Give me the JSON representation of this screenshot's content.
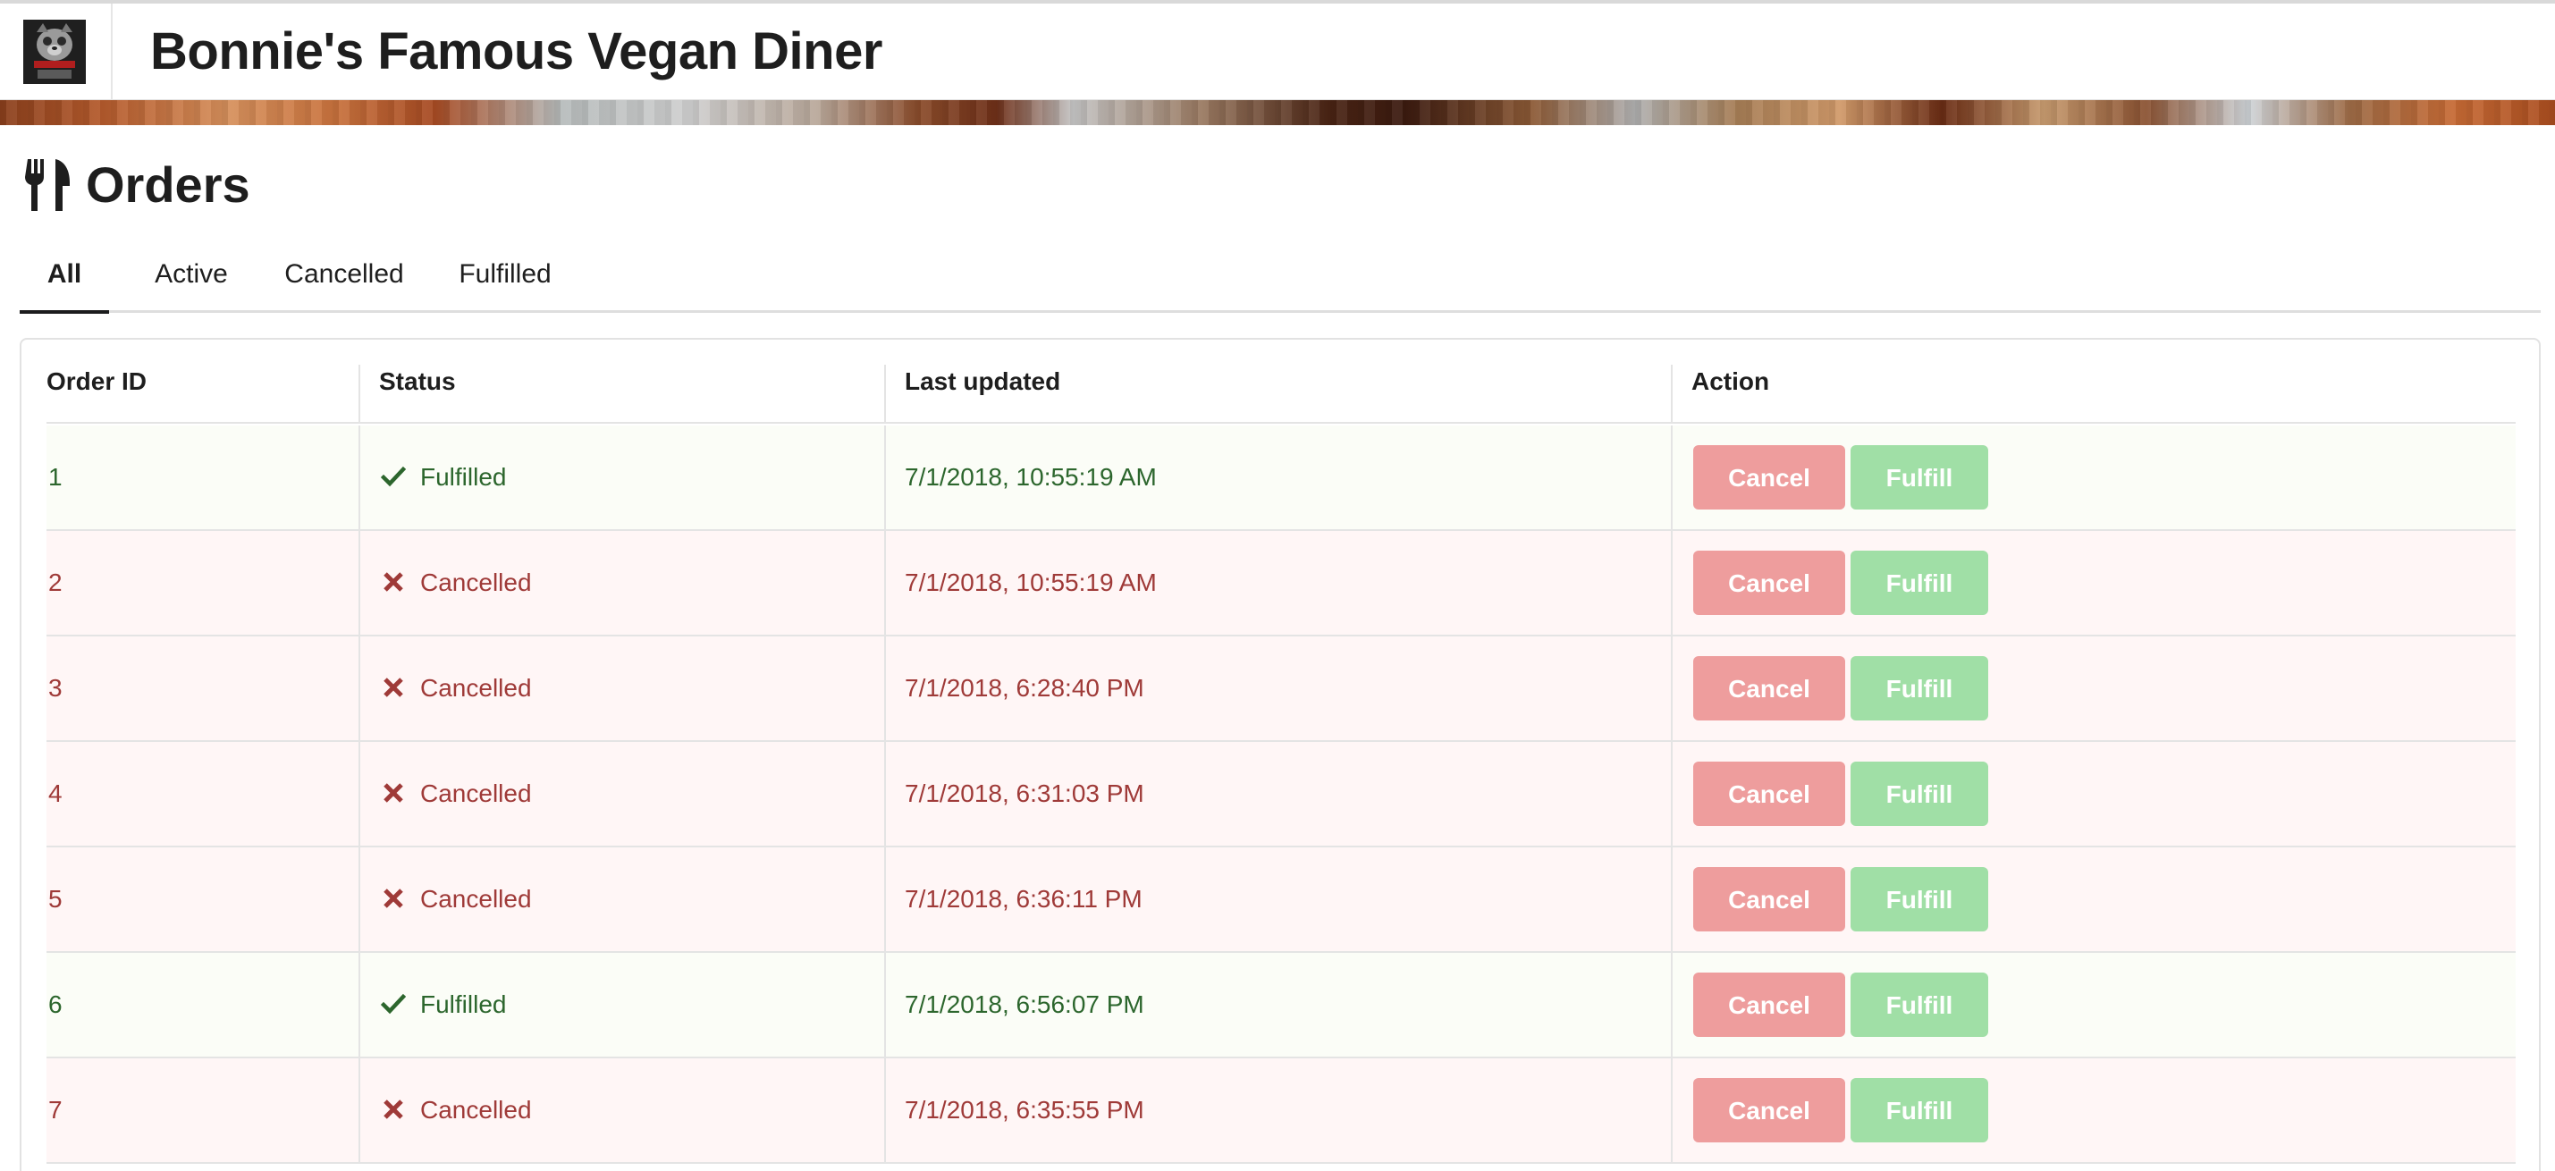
{
  "app": {
    "title": "Bonnie's Famous Vegan Diner",
    "logo_icon": "diner-logo-icon"
  },
  "page": {
    "title": "Orders",
    "icon": "utensils-icon"
  },
  "tabs": [
    {
      "label": "All",
      "active": true
    },
    {
      "label": "Active",
      "active": false
    },
    {
      "label": "Cancelled",
      "active": false
    },
    {
      "label": "Fulfilled",
      "active": false
    }
  ],
  "table": {
    "columns": [
      "Order ID",
      "Status",
      "Last updated",
      "Action"
    ],
    "cancel_label": "Cancel",
    "fulfill_label": "Fulfill",
    "rows": [
      {
        "id": "1",
        "status": "Fulfilled",
        "updated": "7/1/2018, 10:55:19 AM"
      },
      {
        "id": "2",
        "status": "Cancelled",
        "updated": "7/1/2018, 10:55:19 AM"
      },
      {
        "id": "3",
        "status": "Cancelled",
        "updated": "7/1/2018, 6:28:40 PM"
      },
      {
        "id": "4",
        "status": "Cancelled",
        "updated": "7/1/2018, 6:31:03 PM"
      },
      {
        "id": "5",
        "status": "Cancelled",
        "updated": "7/1/2018, 6:36:11 PM"
      },
      {
        "id": "6",
        "status": "Fulfilled",
        "updated": "7/1/2018, 6:56:07 PM"
      },
      {
        "id": "7",
        "status": "Cancelled",
        "updated": "7/1/2018, 6:35:55 PM"
      }
    ]
  },
  "colors": {
    "fulfilled_text": "#2c662d",
    "fulfilled_bg": "#fbfdf7",
    "cancelled_text": "#9f3a38",
    "cancelled_bg": "#fff6f6",
    "cancel_button": "#ee9d9d",
    "fulfill_button": "#a0dfa6"
  }
}
